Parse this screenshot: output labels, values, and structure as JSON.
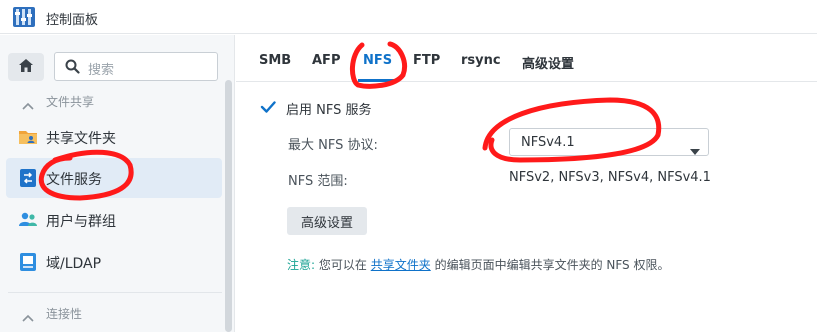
{
  "window": {
    "title": "控制面板",
    "app_icon": "control-panel-icon"
  },
  "sidebar": {
    "search_placeholder": "搜索",
    "sections": [
      {
        "label": "文件共享",
        "expanded": true
      },
      {
        "label": "连接性",
        "expanded": true
      }
    ],
    "items": [
      {
        "label": "共享文件夹",
        "icon": "shared-folder-icon"
      },
      {
        "label": "文件服务",
        "icon": "file-services-icon",
        "active": true
      },
      {
        "label": "用户与群组",
        "icon": "users-groups-icon"
      },
      {
        "label": "域/LDAP",
        "icon": "domain-ldap-icon"
      }
    ]
  },
  "tabs": [
    {
      "label": "SMB"
    },
    {
      "label": "AFP"
    },
    {
      "label": "NFS",
      "active": true
    },
    {
      "label": "FTP"
    },
    {
      "label": "rsync"
    },
    {
      "label": "高级设置"
    }
  ],
  "nfs": {
    "enable_label": "启用 NFS 服务",
    "enable_checked": true,
    "max_protocol_label": "最大 NFS 协议:",
    "max_protocol_value": "NFSv4.1",
    "range_label": "NFS 范围:",
    "range_value": "NFSv2, NFSv3, NFSv4, NFSv4.1",
    "advanced_button": "高级设置",
    "note_prefix": "注意:",
    "note_text_1": "您可以在",
    "note_link": "共享文件夹",
    "note_text_2": "的编辑页面中编辑共享文件夹的 NFS 权限。"
  },
  "colors": {
    "accent": "#0f72c9",
    "annotation_red": "#ff1a1a",
    "note_green": "#1aa394"
  }
}
